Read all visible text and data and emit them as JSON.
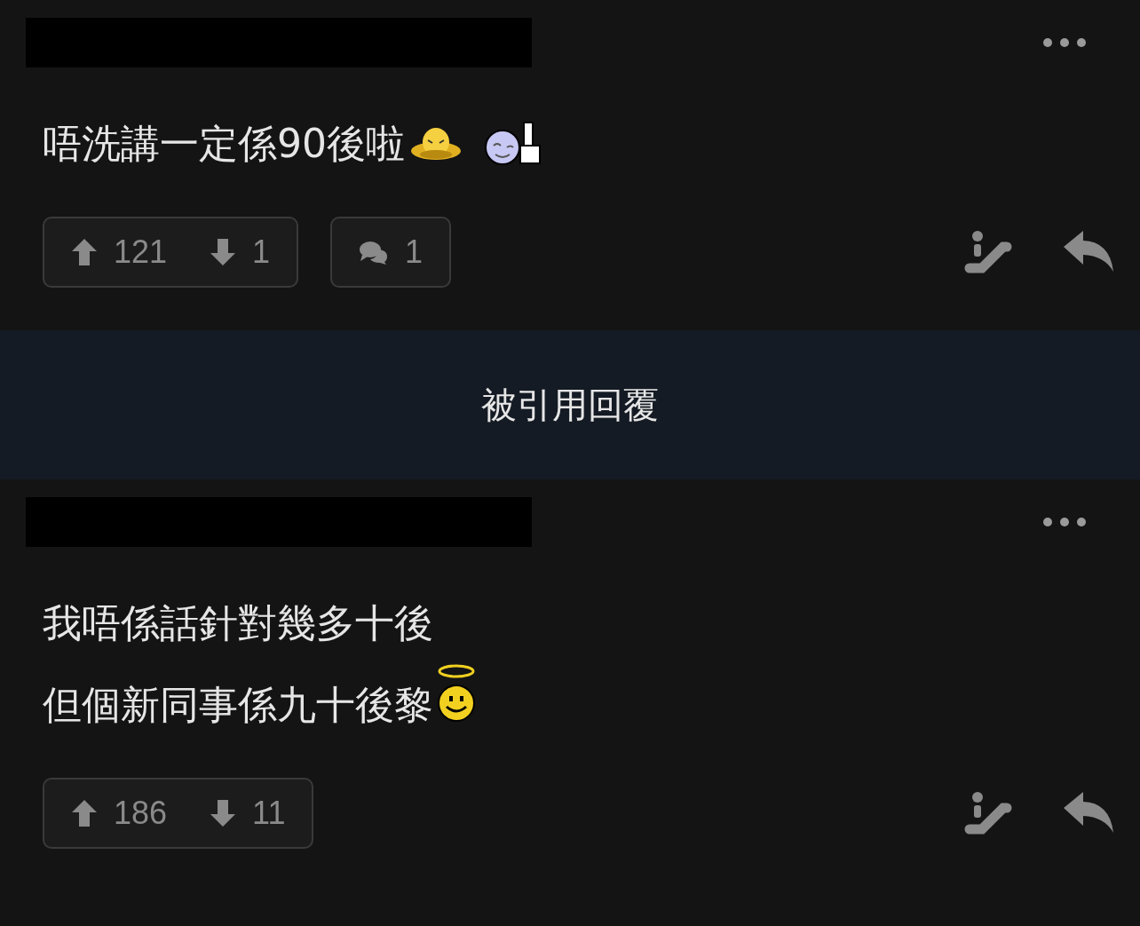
{
  "posts": [
    {
      "lines": [
        {
          "text": "唔洗講一定係90後啦",
          "emoticons": [
            {
              "kind": "hat"
            },
            {
              "kind": "thumbs"
            }
          ]
        }
      ],
      "upvotes": "121",
      "downvotes": "1",
      "comments": "1"
    },
    {
      "lines": [
        {
          "text": "我唔係話針對幾多十後"
        },
        {
          "text": "但個新同事係九十後黎",
          "emoticons": [
            {
              "kind": "angel"
            }
          ]
        }
      ],
      "upvotes": "186",
      "downvotes": "11"
    }
  ],
  "quoted_banner": "被引用回覆"
}
